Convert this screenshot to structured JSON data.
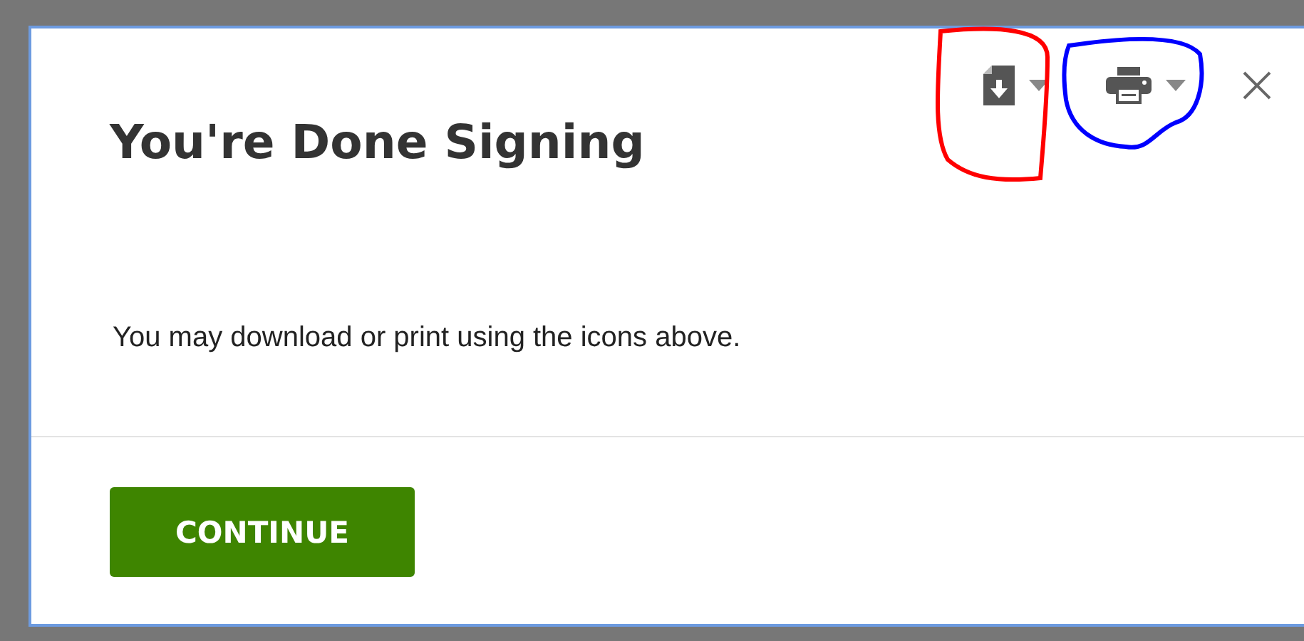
{
  "dialog": {
    "title": "You're Done Signing",
    "message": "You may download or print using the icons above.",
    "toolbar": [
      {
        "kind": "download"
      },
      {
        "kind": "print"
      },
      {
        "kind": "close"
      }
    ],
    "button": "CONTINUE"
  },
  "annotations": [
    {
      "color": "#ff0000"
    },
    {
      "color": "#0000ff"
    }
  ]
}
